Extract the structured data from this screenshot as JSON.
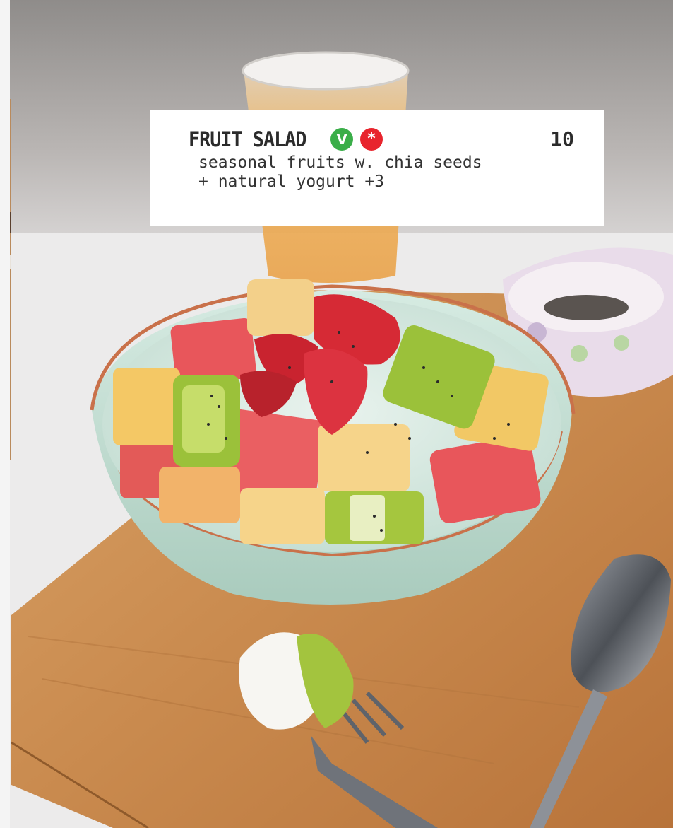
{
  "menu_item": {
    "name": "FRUIT SALAD",
    "price": "10",
    "description_line1": "seasonal fruits w. chia seeds",
    "description_line2": "+ natural yogurt +3",
    "badges": [
      {
        "label": "V",
        "color": "#3aae49",
        "meaning": "vegan-icon"
      },
      {
        "label": "*",
        "color": "#e8242d",
        "meaning": "asterisk-icon"
      }
    ]
  },
  "photo": {
    "subject": "fruit-salad-bowl",
    "colors": {
      "tablecloth": "#eceaea",
      "board": "#c98a4e",
      "bowl": "#cfe6dc",
      "bowl_rim": "#c9714a",
      "watermelon": "#e8565b",
      "kiwi": "#9bc13a",
      "pineapple": "#f2c865",
      "strawberry": "#d62a35"
    }
  }
}
